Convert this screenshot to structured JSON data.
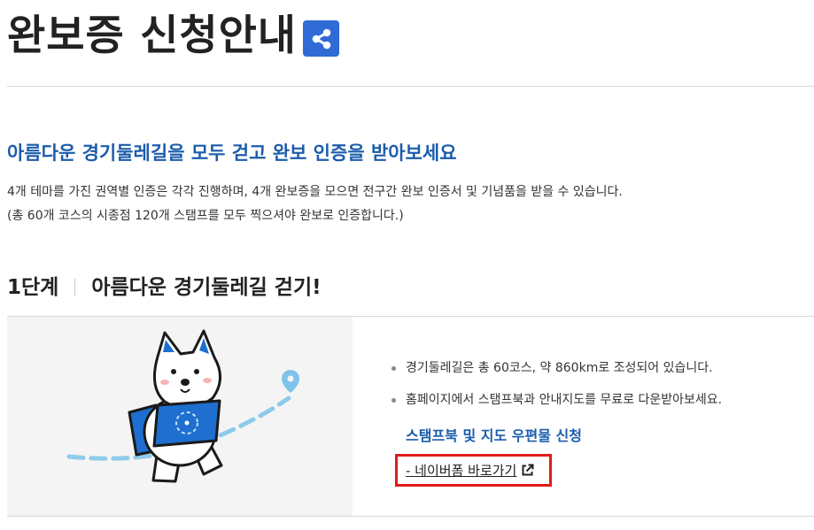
{
  "header": {
    "title": "완보증 신청안내",
    "share_icon": "share-icon"
  },
  "intro": {
    "heading": "아름다운 경기둘레길을 모두 걷고 완보 인증을 받아보세요",
    "line1": "4개 테마를 가진 권역별 인증은 각각 진행하며, 4개 완보증을 모으면 전구간 완보 인증서 및 기념품을 받을 수 있습니다.",
    "line2": "(총 60개 코스의 시종점 120개 스탬프를 모두 찍으셔야 완보로 인증합니다.)"
  },
  "step": {
    "number": "1단계",
    "title": "아름다운 경기둘레길 걷기!"
  },
  "content": {
    "illustration": "mascot-walking-with-map",
    "bullets": [
      "경기둘레길은 총 60코스, 약 860km로 조성되어 있습니다.",
      "홈페이지에서 스탬프북과 안내지도를 무료로 다운받아보세요."
    ],
    "sub_heading": "스탬프북 및 지도 우편물 신청",
    "naver_link": "- 네이버폼 바로가기",
    "external_icon": "external-link-icon"
  },
  "colors": {
    "accent_blue": "#1c5cab",
    "share_bg": "#2f6ad6",
    "highlight_red": "#e01b1b"
  }
}
